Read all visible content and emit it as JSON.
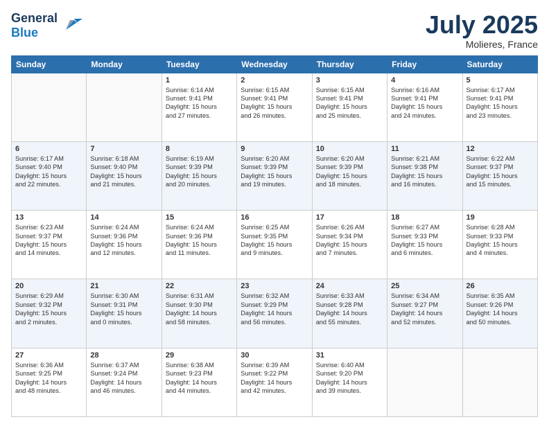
{
  "header": {
    "logo_line1": "General",
    "logo_line2": "Blue",
    "month": "July 2025",
    "location": "Molieres, France"
  },
  "weekdays": [
    "Sunday",
    "Monday",
    "Tuesday",
    "Wednesday",
    "Thursday",
    "Friday",
    "Saturday"
  ],
  "weeks": [
    [
      {
        "day": "",
        "text": ""
      },
      {
        "day": "",
        "text": ""
      },
      {
        "day": "1",
        "text": "Sunrise: 6:14 AM\nSunset: 9:41 PM\nDaylight: 15 hours\nand 27 minutes."
      },
      {
        "day": "2",
        "text": "Sunrise: 6:15 AM\nSunset: 9:41 PM\nDaylight: 15 hours\nand 26 minutes."
      },
      {
        "day": "3",
        "text": "Sunrise: 6:15 AM\nSunset: 9:41 PM\nDaylight: 15 hours\nand 25 minutes."
      },
      {
        "day": "4",
        "text": "Sunrise: 6:16 AM\nSunset: 9:41 PM\nDaylight: 15 hours\nand 24 minutes."
      },
      {
        "day": "5",
        "text": "Sunrise: 6:17 AM\nSunset: 9:41 PM\nDaylight: 15 hours\nand 23 minutes."
      }
    ],
    [
      {
        "day": "6",
        "text": "Sunrise: 6:17 AM\nSunset: 9:40 PM\nDaylight: 15 hours\nand 22 minutes."
      },
      {
        "day": "7",
        "text": "Sunrise: 6:18 AM\nSunset: 9:40 PM\nDaylight: 15 hours\nand 21 minutes."
      },
      {
        "day": "8",
        "text": "Sunrise: 6:19 AM\nSunset: 9:39 PM\nDaylight: 15 hours\nand 20 minutes."
      },
      {
        "day": "9",
        "text": "Sunrise: 6:20 AM\nSunset: 9:39 PM\nDaylight: 15 hours\nand 19 minutes."
      },
      {
        "day": "10",
        "text": "Sunrise: 6:20 AM\nSunset: 9:39 PM\nDaylight: 15 hours\nand 18 minutes."
      },
      {
        "day": "11",
        "text": "Sunrise: 6:21 AM\nSunset: 9:38 PM\nDaylight: 15 hours\nand 16 minutes."
      },
      {
        "day": "12",
        "text": "Sunrise: 6:22 AM\nSunset: 9:37 PM\nDaylight: 15 hours\nand 15 minutes."
      }
    ],
    [
      {
        "day": "13",
        "text": "Sunrise: 6:23 AM\nSunset: 9:37 PM\nDaylight: 15 hours\nand 14 minutes."
      },
      {
        "day": "14",
        "text": "Sunrise: 6:24 AM\nSunset: 9:36 PM\nDaylight: 15 hours\nand 12 minutes."
      },
      {
        "day": "15",
        "text": "Sunrise: 6:24 AM\nSunset: 9:36 PM\nDaylight: 15 hours\nand 11 minutes."
      },
      {
        "day": "16",
        "text": "Sunrise: 6:25 AM\nSunset: 9:35 PM\nDaylight: 15 hours\nand 9 minutes."
      },
      {
        "day": "17",
        "text": "Sunrise: 6:26 AM\nSunset: 9:34 PM\nDaylight: 15 hours\nand 7 minutes."
      },
      {
        "day": "18",
        "text": "Sunrise: 6:27 AM\nSunset: 9:33 PM\nDaylight: 15 hours\nand 6 minutes."
      },
      {
        "day": "19",
        "text": "Sunrise: 6:28 AM\nSunset: 9:33 PM\nDaylight: 15 hours\nand 4 minutes."
      }
    ],
    [
      {
        "day": "20",
        "text": "Sunrise: 6:29 AM\nSunset: 9:32 PM\nDaylight: 15 hours\nand 2 minutes."
      },
      {
        "day": "21",
        "text": "Sunrise: 6:30 AM\nSunset: 9:31 PM\nDaylight: 15 hours\nand 0 minutes."
      },
      {
        "day": "22",
        "text": "Sunrise: 6:31 AM\nSunset: 9:30 PM\nDaylight: 14 hours\nand 58 minutes."
      },
      {
        "day": "23",
        "text": "Sunrise: 6:32 AM\nSunset: 9:29 PM\nDaylight: 14 hours\nand 56 minutes."
      },
      {
        "day": "24",
        "text": "Sunrise: 6:33 AM\nSunset: 9:28 PM\nDaylight: 14 hours\nand 55 minutes."
      },
      {
        "day": "25",
        "text": "Sunrise: 6:34 AM\nSunset: 9:27 PM\nDaylight: 14 hours\nand 52 minutes."
      },
      {
        "day": "26",
        "text": "Sunrise: 6:35 AM\nSunset: 9:26 PM\nDaylight: 14 hours\nand 50 minutes."
      }
    ],
    [
      {
        "day": "27",
        "text": "Sunrise: 6:36 AM\nSunset: 9:25 PM\nDaylight: 14 hours\nand 48 minutes."
      },
      {
        "day": "28",
        "text": "Sunrise: 6:37 AM\nSunset: 9:24 PM\nDaylight: 14 hours\nand 46 minutes."
      },
      {
        "day": "29",
        "text": "Sunrise: 6:38 AM\nSunset: 9:23 PM\nDaylight: 14 hours\nand 44 minutes."
      },
      {
        "day": "30",
        "text": "Sunrise: 6:39 AM\nSunset: 9:22 PM\nDaylight: 14 hours\nand 42 minutes."
      },
      {
        "day": "31",
        "text": "Sunrise: 6:40 AM\nSunset: 9:20 PM\nDaylight: 14 hours\nand 39 minutes."
      },
      {
        "day": "",
        "text": ""
      },
      {
        "day": "",
        "text": ""
      }
    ]
  ]
}
